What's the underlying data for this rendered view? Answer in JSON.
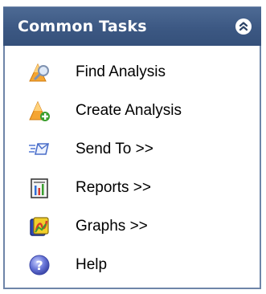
{
  "panel": {
    "title": "Common Tasks",
    "collapse_icon": "double-chevron-up-icon"
  },
  "tasks": [
    {
      "label": "Find Analysis",
      "icon": "find-analysis-icon"
    },
    {
      "label": "Create Analysis",
      "icon": "create-analysis-icon"
    },
    {
      "label": "Send To >>",
      "icon": "send-to-icon"
    },
    {
      "label": "Reports >>",
      "icon": "reports-icon"
    },
    {
      "label": "Graphs >>",
      "icon": "graphs-icon"
    },
    {
      "label": "Help",
      "icon": "help-icon"
    }
  ],
  "colors": {
    "header": "#3c5883",
    "border": "#6e85a8",
    "accent_orange": "#f5a531",
    "accent_green": "#3a9e2f",
    "help_blue": "#6673d6"
  }
}
